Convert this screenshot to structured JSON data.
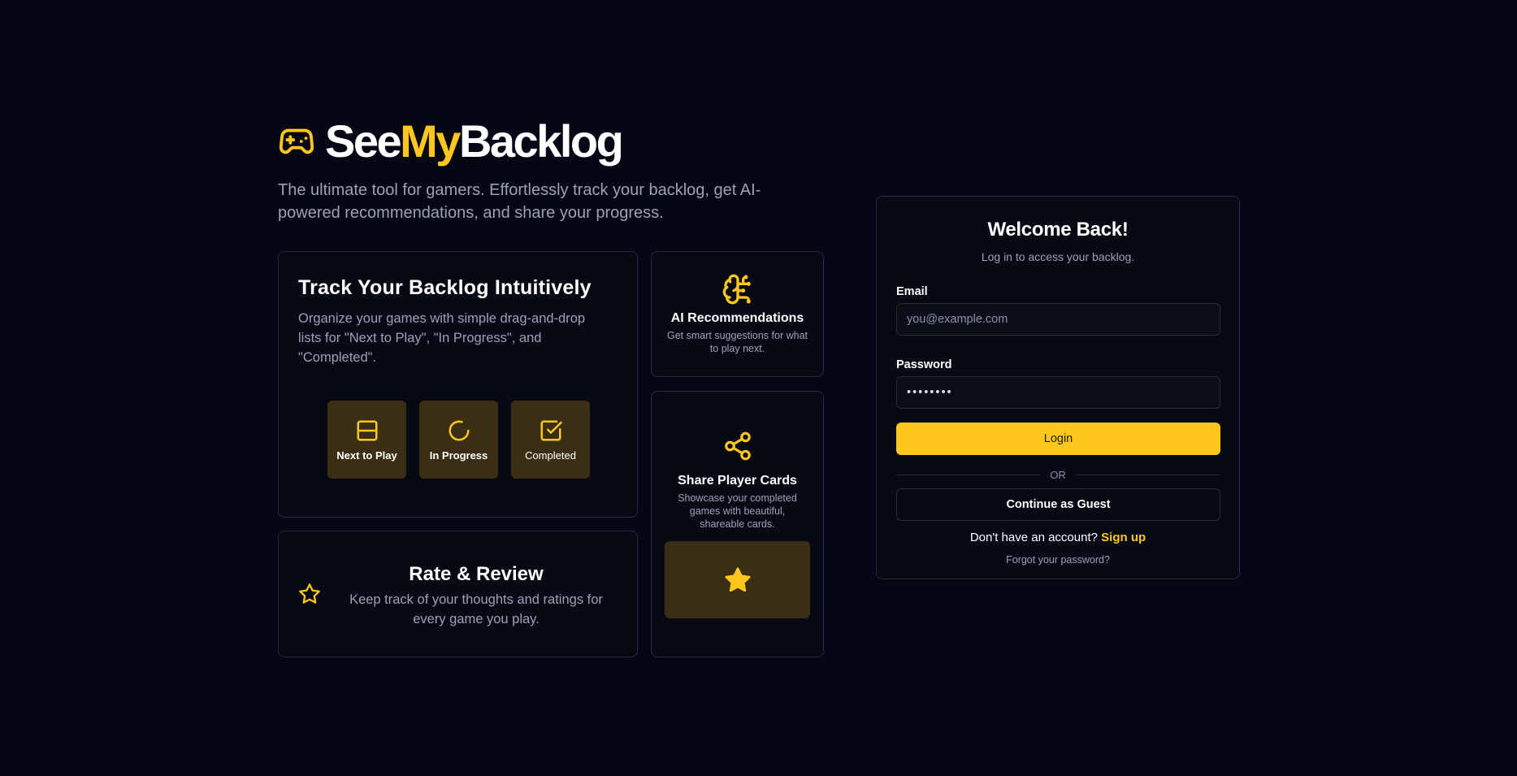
{
  "brand": {
    "title_part1": "See",
    "title_accent": "My",
    "title_part2": "Backlog",
    "icon": "gamepad-icon",
    "tagline": "The ultimate tool for gamers. Effortlessly track your backlog, get AI-powered recommendations, and share your progress."
  },
  "colors": {
    "background": "#050814",
    "accent": "#ffc61c",
    "card_border": "#262b37",
    "tile_bg": "#3a2f14",
    "muted_text": "#9aa3b2"
  },
  "features": {
    "track": {
      "title": "Track Your Backlog Intuitively",
      "description": "Organize your games with simple drag-and-drop lists for \"Next to Play\", \"In Progress\", and \"Completed\".",
      "tiles": [
        {
          "label": "Next to Play",
          "icon": "layout-rows-icon"
        },
        {
          "label": "In Progress",
          "icon": "loader-circle-icon"
        },
        {
          "label": "Completed",
          "icon": "check-square-icon"
        }
      ]
    },
    "ai": {
      "title": "AI Recommendations",
      "description": "Get smart suggestions for what to play next.",
      "icon": "brain-circuit-icon"
    },
    "share": {
      "title": "Share Player Cards",
      "description": "Showcase your completed games with beautiful, shareable cards.",
      "icon": "share-icon",
      "preview_icon": "star-filled-icon"
    },
    "rate": {
      "title": "Rate & Review",
      "description": "Keep track of your thoughts and ratings for every game you play.",
      "icon": "star-outline-icon"
    }
  },
  "login": {
    "title": "Welcome Back!",
    "subtitle": "Log in to access your backlog.",
    "email_label": "Email",
    "email_placeholder": "you@example.com",
    "password_label": "Password",
    "password_value": "••••••••",
    "login_button": "Login",
    "divider": "OR",
    "guest_button": "Continue as Guest",
    "no_account_text": "Don't have an account?",
    "signup_link": "Sign up",
    "forgot_link": "Forgot your password?"
  }
}
